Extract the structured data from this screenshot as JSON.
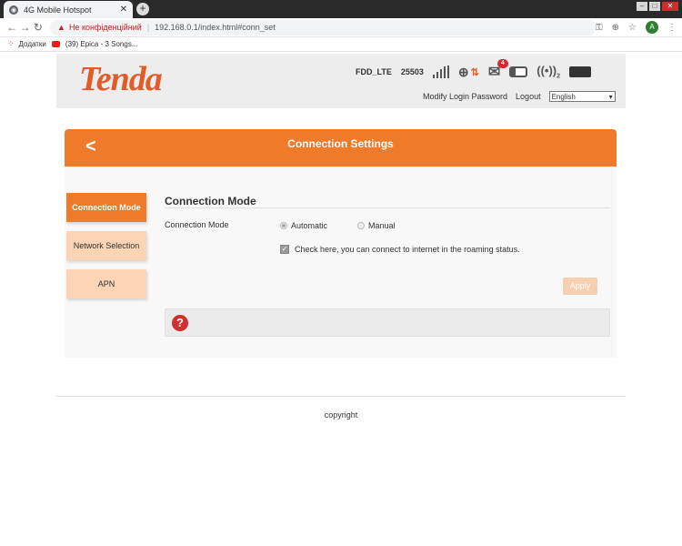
{
  "browser": {
    "tab_title": "4G Mobile Hotspot",
    "tab_close": "✕",
    "new_tab": "+",
    "security_warning": "Не конфіденційний",
    "url": "192.168.0.1/index.html#conn_set",
    "profile_initial": "A",
    "bookmarks": {
      "apps_label": "Додатки",
      "item1": "(39) Epica - 3 Songs..."
    }
  },
  "header": {
    "logo": "Tenda",
    "network_name": "FDD_LTE",
    "network_code": "25503",
    "message_count": "4",
    "wifi_clients": "2",
    "modify_password": "Modify Login Password",
    "logout": "Logout",
    "language": "English"
  },
  "page": {
    "title": "Connection Settings",
    "sidebar": [
      "Connection Mode",
      "Network Selection",
      "APN"
    ],
    "section_title": "Connection Mode",
    "field_label": "Connection Mode",
    "options": [
      "Automatic",
      "Manual"
    ],
    "selected_option": "Automatic",
    "roaming_text": "Check here, you can connect to internet in the roaming status.",
    "roaming_checked": true,
    "apply_label": "Apply",
    "help_icon": "?"
  },
  "footer": {
    "copyright": "copyright"
  },
  "colors": {
    "brand": "#e35b26",
    "accent": "#ef7a2a",
    "accent_light": "#fbd3b5"
  },
  "icons": [
    "back-icon",
    "forward-icon",
    "reload-icon",
    "warning-icon",
    "key-icon",
    "zoom-icon",
    "star-icon",
    "menu-icon",
    "signal-icon",
    "globe-icon",
    "mail-icon",
    "sim-icon",
    "wifi-icon",
    "battery-icon",
    "help-icon",
    "chevron-left-icon"
  ]
}
